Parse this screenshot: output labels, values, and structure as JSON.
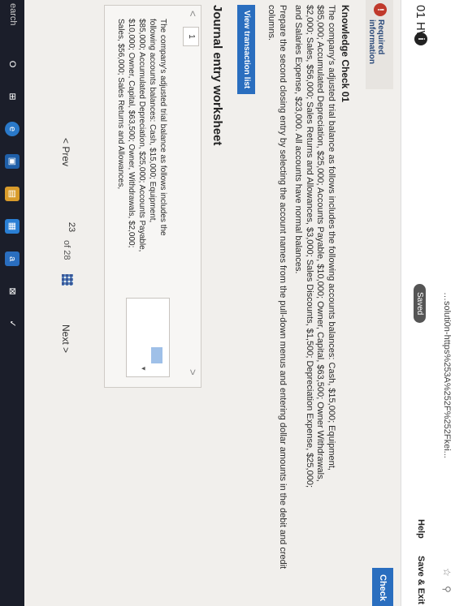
{
  "browser": {
    "url": "…soluti0n-https%253A%252F%252Fkei...",
    "star": "☆",
    "ext": "⚲"
  },
  "header": {
    "title": "01 HW",
    "info": "i",
    "saved": "Saved",
    "help": "Help",
    "save_exit": "Save & Exit"
  },
  "required": {
    "icon": "!",
    "label": "Required information"
  },
  "check_button": "Check",
  "knowledge_check": {
    "heading": "Knowledge Check 01",
    "text": "The company's adjusted trial balance as follows includes the following accounts balances: Cash, $15,000; Equipment, $85,000; Accumulated Depreciation, $25,000; Accounts Payable, $10,000; Owner, Capital, $63,500; Owner Withdrawals, $2,000; Sales, $56,000; Sales Returns and Allowances, $3,000; Sales Discounts, $1,500; Depreciation Expense, $25,000; and Salaries Expense, $23,000. All accounts have normal balances."
  },
  "instruction": "Prepare the second closing entry by selecting the account names from the pull-down menus and entering dollar amounts in the debit and credit columns.",
  "view_button": "View transaction list",
  "worksheet": {
    "title": "Journal entry worksheet",
    "prev_arrow": "<",
    "tab": "1",
    "next_arrow": ">",
    "text": "The company's adjusted trial balance as follows includes the following accounts balances: Cash, $15,000; Equipment, $85,000; Accumulated Depreciation, $25,000; Accounts Payable, $10,000; Owner, Capital, $63,500; Owner, Withdrawals, $2,000; Sales, $56,000; Sales Returns and Allowances,",
    "caret": "▾"
  },
  "pager": {
    "prev": "< Prev",
    "current": "23",
    "of": "of 28",
    "next": "Next >"
  },
  "taskbar": {
    "search": "earch",
    "icons": [
      "O",
      "⊞",
      "e",
      "▣",
      "▤",
      "▦",
      "a",
      "⊠",
      "✓"
    ]
  },
  "colors": {
    "accent": "#2a6ebf",
    "required_text": "#2b4a7a",
    "taskbar": "#1b1e2a"
  }
}
